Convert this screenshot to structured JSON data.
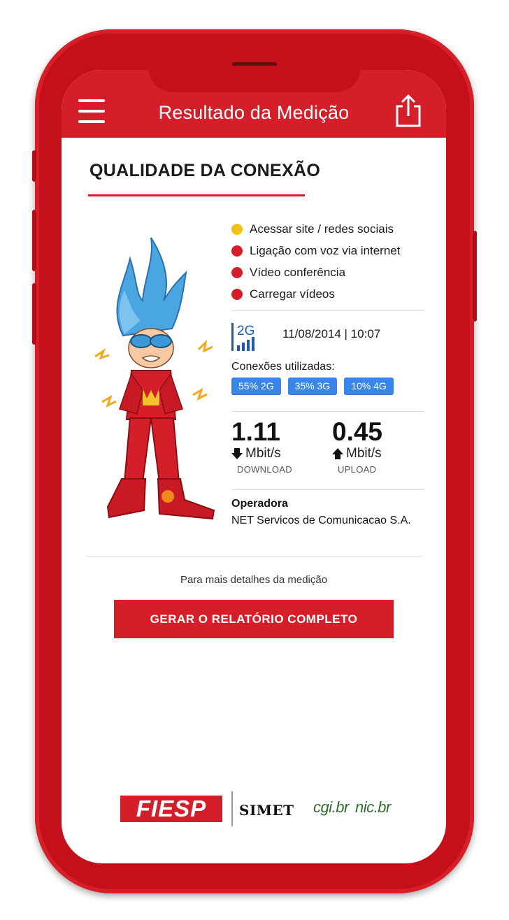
{
  "appbar": {
    "title": "Resultado da Medição",
    "menu_icon": "hamburger-menu-icon",
    "share_icon": "share-icon"
  },
  "section": {
    "title": "QUALIDADE DA CONEXÃO"
  },
  "quality_items": [
    {
      "label": "Acessar site / redes sociais",
      "color": "#f2c21b"
    },
    {
      "label": "Ligação com voz via internet",
      "color": "#d41f2b"
    },
    {
      "label": "Vídeo conferência",
      "color": "#d41f2b"
    },
    {
      "label": "Carregar vídeos",
      "color": "#d41f2b"
    }
  ],
  "network": {
    "type_label": "2G",
    "datetime": "11/08/2014 | 10:07"
  },
  "connections": {
    "label": "Conexões utilizadas:",
    "badges": [
      "55% 2G",
      "35% 3G",
      "10% 4G"
    ]
  },
  "download": {
    "value": "1.11",
    "unit": "Mbit/s",
    "label": "DOWNLOAD"
  },
  "upload": {
    "value": "0.45",
    "unit": "Mbit/s",
    "label": "UPLOAD"
  },
  "operator": {
    "label": "Operadora",
    "name": "NET Servicos de Comunicacao S.A."
  },
  "details_text": "Para mais detalhes da medição",
  "report_button": "GERAR O RELATÓRIO COMPLETO",
  "footer_logos": {
    "fiesp": "FIESP",
    "simet": "SIMET",
    "cgi": "cgi.br",
    "nic": "nic.br"
  },
  "colors": {
    "brand_red": "#d41f2b",
    "badge_blue": "#3a86e8",
    "status_yellow": "#f2c21b"
  }
}
